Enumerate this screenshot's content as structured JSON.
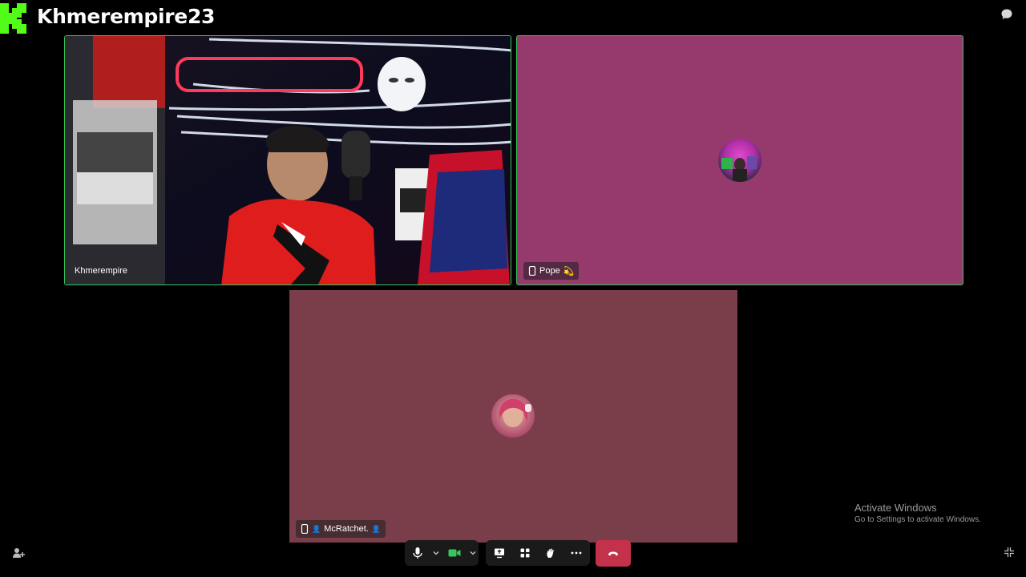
{
  "header": {
    "channel_name": "Khmerempire23",
    "logo_icon": "kick-logo-icon",
    "chat_icon": "chat-bubble-icon",
    "brand_color": "#53fc18"
  },
  "participants": [
    {
      "name": "Khmerempire",
      "tile_color": "#0a0a14",
      "active_speaker": true
    },
    {
      "name": "Pope",
      "suffix_emoji": "💫",
      "device_icon": "phone-icon",
      "tile_color": "#963a6e",
      "active_speaker": true
    },
    {
      "name": "McRatchet.",
      "prefix_emoji": "👤",
      "suffix_emoji": "👤",
      "device_icon": "phone-icon",
      "tile_color": "#7a3e4a",
      "active_speaker": false
    }
  ],
  "watermark": {
    "title": "Activate Windows",
    "subtitle": "Go to Settings to activate Windows."
  },
  "toolbar": {
    "icons": [
      "microphone-icon",
      "chevron-down-icon",
      "camera-icon",
      "chevron-down-icon",
      "share-screen-icon",
      "apps-icon",
      "raise-hand-icon",
      "more-icon",
      "hang-up-icon"
    ],
    "camera_on_color": "#35c759",
    "hangup_color": "#c4314b"
  }
}
